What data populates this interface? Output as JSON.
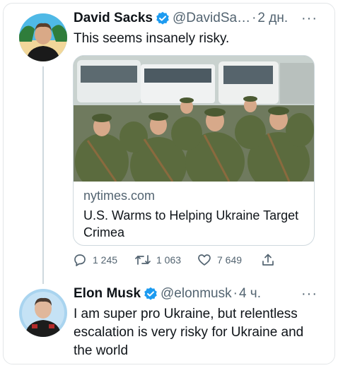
{
  "tweets": [
    {
      "author_name": "David Sacks",
      "handle": "@DavidSa…",
      "separator": "·",
      "time": "2 дн.",
      "text": "This seems insanely risky.",
      "more_icon": "more-dots-icon",
      "card": {
        "domain": "nytimes.com",
        "title": "U.S. Warms to Helping Ukraine Target Crimea"
      },
      "stats": {
        "replies": "1 245",
        "retweets": "1 063",
        "likes": "7 649"
      }
    },
    {
      "author_name": "Elon Musk",
      "handle": "@elonmusk",
      "separator": "·",
      "time": "4 ч.",
      "text": "I am super pro Ukraine, but relentless escalation is very risky for Ukraine and the world",
      "more_icon": "more-dots-icon"
    }
  ],
  "colors": {
    "verified": "#1d9bf0",
    "secondary_text": "#536471",
    "border": "#cfd9de"
  },
  "more_label": "···"
}
